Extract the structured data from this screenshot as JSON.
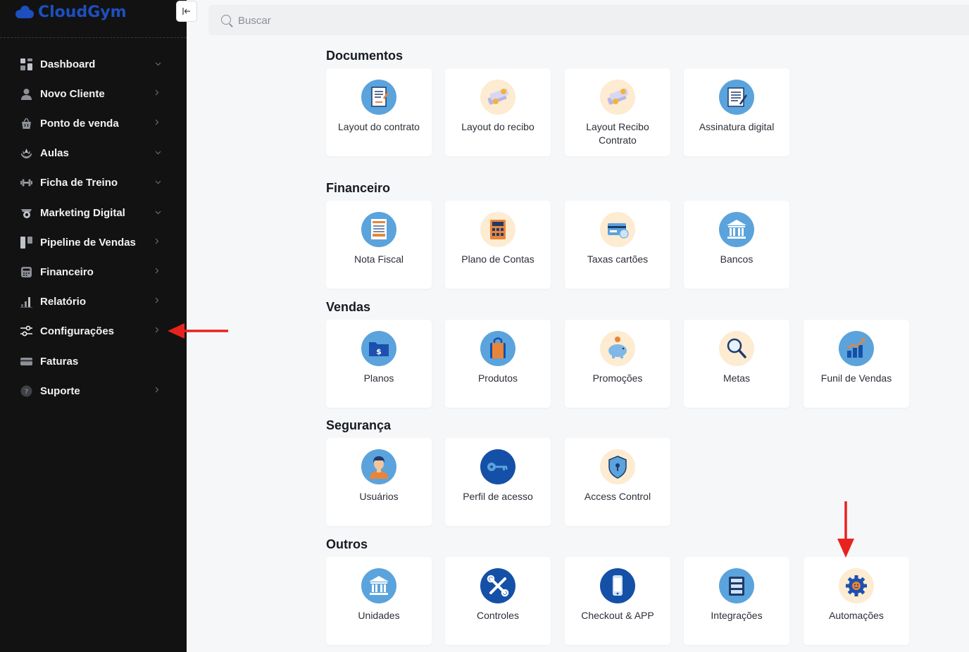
{
  "app": {
    "name": "CloudGym"
  },
  "sidebar": {
    "items": [
      {
        "label": "Dashboard",
        "caret": "down"
      },
      {
        "label": "Novo Cliente",
        "caret": "right"
      },
      {
        "label": "Ponto de venda",
        "caret": "right"
      },
      {
        "label": "Aulas",
        "caret": "down"
      },
      {
        "label": "Ficha de Treino",
        "caret": "down"
      },
      {
        "label": "Marketing Digital",
        "caret": "down"
      },
      {
        "label": "Pipeline de Vendas",
        "caret": "right"
      },
      {
        "label": "Financeiro",
        "caret": "right"
      },
      {
        "label": "Relatório",
        "caret": "right"
      },
      {
        "label": "Configurações",
        "caret": "right"
      },
      {
        "label": "Faturas",
        "caret": ""
      },
      {
        "label": "Suporte",
        "caret": "right"
      }
    ]
  },
  "search": {
    "placeholder": "Buscar",
    "value": ""
  },
  "sections": [
    {
      "title": "Documentos",
      "cards": [
        {
          "label": "Layout do contrato",
          "icon": "contract-document-icon"
        },
        {
          "label": "Layout do recibo",
          "icon": "receipt-money-icon"
        },
        {
          "label": "Layout Recibo Contrato",
          "icon": "receipt-contract-icon"
        },
        {
          "label": "Assinatura digital",
          "icon": "digital-signature-icon"
        }
      ]
    },
    {
      "title": "Financeiro",
      "cards": [
        {
          "label": "Nota Fiscal",
          "icon": "invoice-icon"
        },
        {
          "label": "Plano de Contas",
          "icon": "calculator-icon"
        },
        {
          "label": "Taxas cartões",
          "icon": "credit-card-icon"
        },
        {
          "label": "Bancos",
          "icon": "bank-icon"
        }
      ]
    },
    {
      "title": "Vendas",
      "cards": [
        {
          "label": "Planos",
          "icon": "folder-dollar-icon"
        },
        {
          "label": "Produtos",
          "icon": "shopping-bag-icon"
        },
        {
          "label": "Promoções",
          "icon": "piggy-bank-icon"
        },
        {
          "label": "Metas",
          "icon": "magnifier-icon"
        },
        {
          "label": "Funil de Vendas",
          "icon": "growth-chart-icon"
        }
      ]
    },
    {
      "title": "Segurança",
      "cards": [
        {
          "label": "Usuários",
          "icon": "user-icon"
        },
        {
          "label": "Perfil de acesso",
          "icon": "key-icon"
        },
        {
          "label": "Access Control",
          "icon": "shield-lock-icon"
        }
      ]
    },
    {
      "title": "Outros",
      "cards": [
        {
          "label": "Unidades",
          "icon": "building-icon"
        },
        {
          "label": "Controles",
          "icon": "tools-icon"
        },
        {
          "label": "Checkout & APP",
          "icon": "smartphone-icon"
        },
        {
          "label": "Integrações",
          "icon": "server-icon"
        },
        {
          "label": "Automações",
          "icon": "automation-gear-icon"
        }
      ]
    }
  ],
  "colors": {
    "sidebar_bg": "#121212",
    "brand": "#1d4fbf",
    "page_bg": "#f6f7f9",
    "annotation_arrow": "#e8231f"
  }
}
